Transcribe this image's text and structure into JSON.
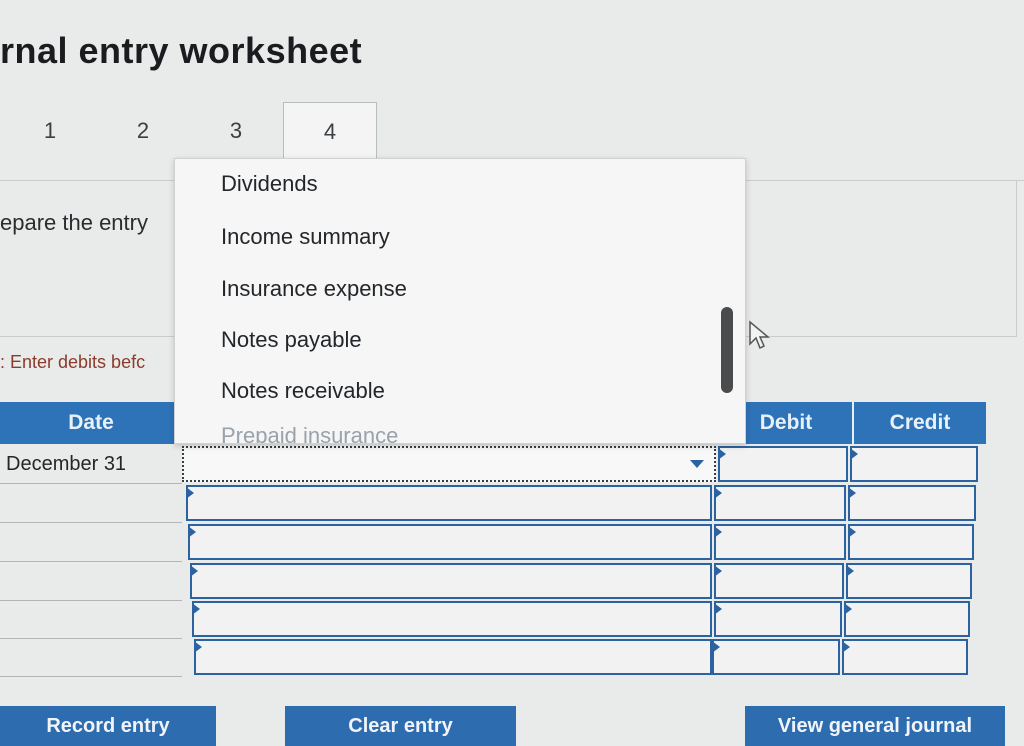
{
  "title": "rnal entry worksheet",
  "tabs": [
    "1",
    "2",
    "3",
    "4"
  ],
  "active_tab": "4",
  "instruction": "epare the entry",
  "note": ": Enter debits befc",
  "table": {
    "headers": {
      "date": "Date",
      "debit": "Debit",
      "credit": "Credit"
    },
    "first_date": "December 31"
  },
  "dropdown": {
    "options": [
      "Dividends",
      "Income summary",
      "Insurance expense",
      "Notes payable",
      "Notes receivable",
      "Prepaid insurance"
    ]
  },
  "buttons": {
    "record": "Record entry",
    "clear": "Clear entry",
    "view": "View general journal"
  },
  "colors": {
    "accent": "#2e73b8",
    "cell_border": "#2d62a1",
    "note": "#8a3b2c"
  }
}
